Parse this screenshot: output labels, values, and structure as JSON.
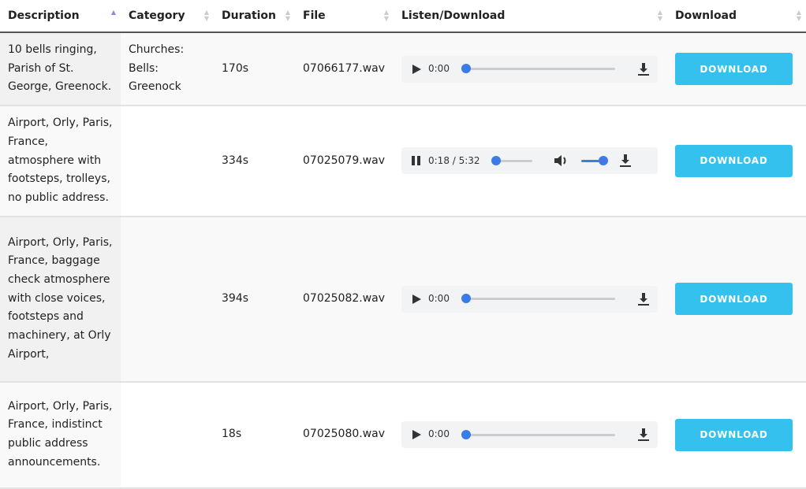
{
  "headers": {
    "description": "Description",
    "category": "Category",
    "duration": "Duration",
    "file": "File",
    "listen": "Listen/Download",
    "download": "Download"
  },
  "rows": [
    {
      "description": "10 bells ringing, Parish of St. George, Greenock.",
      "category": "Churches: Bells: Greenock",
      "duration": "170s",
      "file": "07066177.wav",
      "player": {
        "time": "0:00",
        "state": "paused"
      },
      "download_label": "DOWNLOAD"
    },
    {
      "description": "Airport, Orly, Paris, France, atmosphere with footsteps, trolleys, no public address.",
      "category": "",
      "duration": "334s",
      "file": "07025079.wav",
      "player": {
        "time": "0:18 / 5:32",
        "state": "playing"
      },
      "download_label": "DOWNLOAD"
    },
    {
      "description": "Airport, Orly, Paris, France, baggage check atmosphere with close voices, footsteps and machinery, at Orly Airport,",
      "category": "",
      "duration": "394s",
      "file": "07025082.wav",
      "player": {
        "time": "0:00",
        "state": "paused"
      },
      "download_label": "DOWNLOAD"
    },
    {
      "description": "Airport, Orly, Paris, France, indistinct public address announcements.",
      "category": "",
      "duration": "18s",
      "file": "07025080.wav",
      "player": {
        "time": "0:00",
        "state": "paused"
      },
      "download_label": "DOWNLOAD"
    }
  ],
  "colors": {
    "button": "#35c1ee",
    "progress": "#3b7be8"
  }
}
